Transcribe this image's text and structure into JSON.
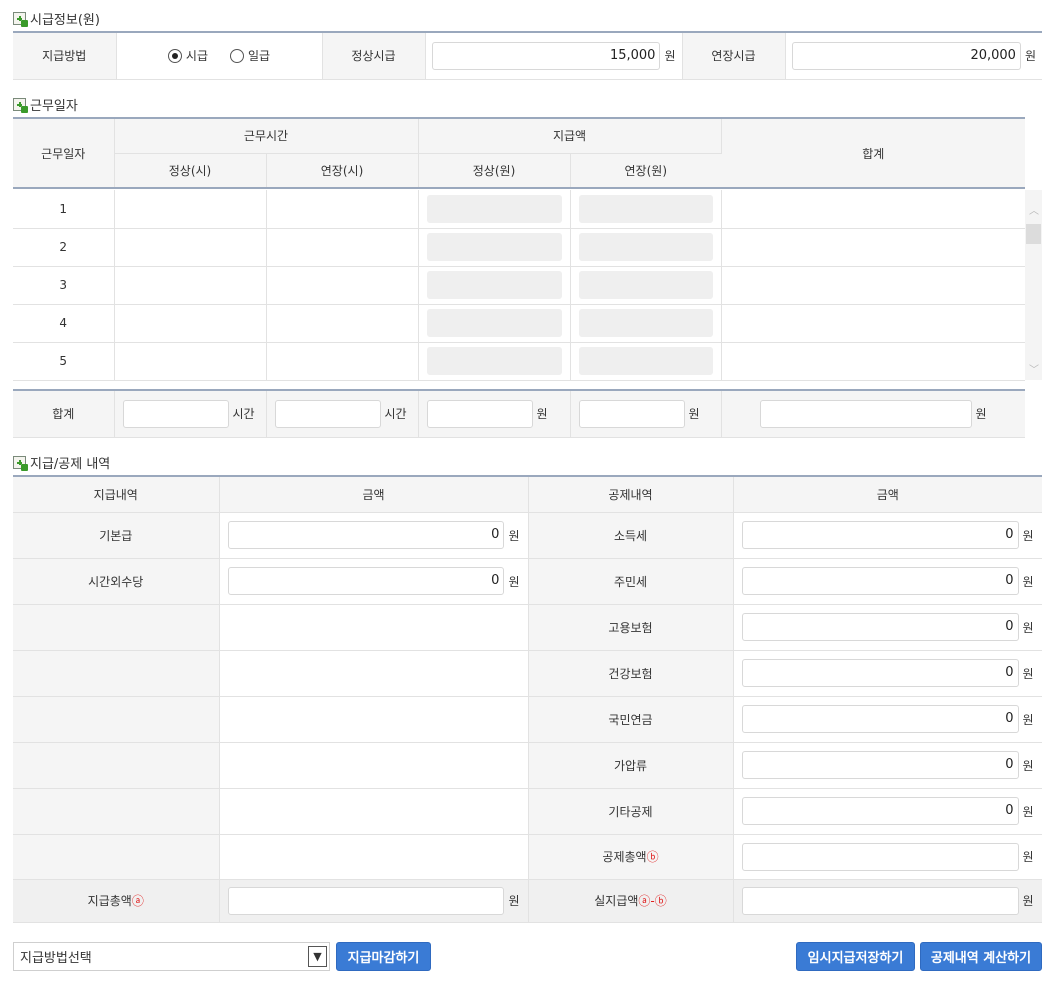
{
  "wage_info": {
    "title": "시급정보(원)",
    "pay_method_label": "지급방법",
    "options": [
      "시급",
      "일급"
    ],
    "selected": "시급",
    "regular_rate_label": "정상시급",
    "regular_rate_value": "15,000",
    "overtime_rate_label": "연장시급",
    "overtime_rate_value": "20,000",
    "unit": "원"
  },
  "workdays": {
    "title": "근무일자",
    "col_day": "근무일자",
    "col_hours": "근무시간",
    "col_pay": "지급액",
    "col_total": "합계",
    "sub_regular_h": "정상(시)",
    "sub_overtime_h": "연장(시)",
    "sub_regular_w": "정상(원)",
    "sub_overtime_w": "연장(원)",
    "rows": [
      "1",
      "2",
      "3",
      "4",
      "5"
    ],
    "footer_label": "합계",
    "hour_unit": "시간",
    "won_unit": "원"
  },
  "payments": {
    "title": "지급/공제 내역",
    "col_pay_items": "지급내역",
    "col_amount": "금액",
    "col_deduct_items": "공제내역",
    "col_amount2": "금액",
    "pay_rows": [
      {
        "label": "기본급",
        "value": "0"
      },
      {
        "label": "시간외수당",
        "value": "0"
      }
    ],
    "deduct_rows": [
      {
        "label": "소득세",
        "value": "0"
      },
      {
        "label": "주민세",
        "value": "0"
      },
      {
        "label": "고용보험",
        "value": "0"
      },
      {
        "label": "건강보험",
        "value": "0"
      },
      {
        "label": "국민연금",
        "value": "0"
      },
      {
        "label": "가압류",
        "value": "0"
      },
      {
        "label": "기타공제",
        "value": "0"
      }
    ],
    "deduct_total_label": "공제총액",
    "deduct_total_mark": "ⓑ",
    "pay_total_label": "지급총액",
    "pay_total_mark": "ⓐ",
    "net_label": "실지급액",
    "net_mark": "ⓐ-ⓑ",
    "unit": "원"
  },
  "footer": {
    "select_value": "지급방법선택",
    "close_button": "지급마감하기",
    "temp_save_button": "임시지급저장하기",
    "calc_button": "공제내역 계산하기"
  },
  "colors": {
    "accent": "#3a7bd5",
    "header_line": "#9aa8bd",
    "mark": "#e02020"
  }
}
